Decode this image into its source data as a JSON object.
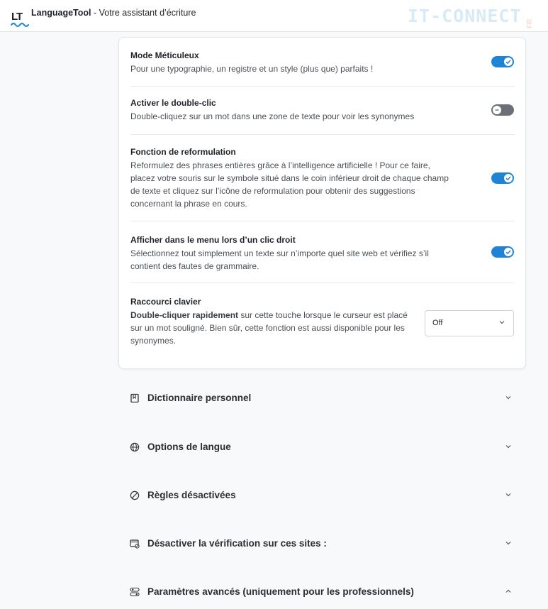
{
  "header": {
    "logo_text": "LT",
    "brand": "LanguageTool",
    "subtitle": " - Votre assistant d’écriture",
    "watermark": "IT-CONNECT",
    "watermark_suffix": "FR"
  },
  "settings": {
    "meticulous": {
      "title": "Mode Méticuleux",
      "desc": "Pour une typographie, un registre et un style (plus que) parfaits !",
      "enabled": true
    },
    "doubleclick": {
      "title": "Activer le double-clic",
      "desc": "Double-cliquez sur un mot dans une zone de texte pour voir les synonymes",
      "enabled": false
    },
    "rephrase": {
      "title": "Fonction de reformulation",
      "desc": "Reformulez des phrases entières grâce à l’intelligence artificielle ! Pour ce faire, placez votre souris sur le symbole situé dans le coin inférieur droit de chaque champ de texte et cliquez sur l’icône de reformulation pour obtenir des suggestions concernant la phrase en cours.",
      "enabled": true
    },
    "contextmenu": {
      "title": "Afficher dans le menu lors d’un clic droit",
      "desc": "Sélectionnez tout simplement un texte sur n’importe quel site web et vérifiez s’il contient des fautes de grammaire.",
      "enabled": true
    },
    "shortcut": {
      "title": "Raccourci clavier",
      "desc_bold": "Double-cliquer rapidement",
      "desc_rest": " sur cette touche lorsque le curseur est placé sur un mot souligné. Bien sûr, cette fonction est aussi disponible pour les synonymes.",
      "selected": "Off"
    }
  },
  "sections": [
    {
      "label": "Dictionnaire personnel",
      "icon": "book-icon",
      "expanded": false
    },
    {
      "label": "Options de langue",
      "icon": "globe-icon",
      "expanded": false
    },
    {
      "label": "Règles désactivées",
      "icon": "disabled-icon",
      "expanded": false
    },
    {
      "label": "Désactiver la vérification sur ces sites :",
      "icon": "browser-blocked-icon",
      "expanded": false
    },
    {
      "label": "Paramètres avancés (uniquement pour les professionnels)",
      "icon": "sliders-icon",
      "expanded": true
    }
  ],
  "colors": {
    "toggle_on": "#1f84d6",
    "toggle_off": "#6b7078",
    "background": "#f8f9fa"
  }
}
